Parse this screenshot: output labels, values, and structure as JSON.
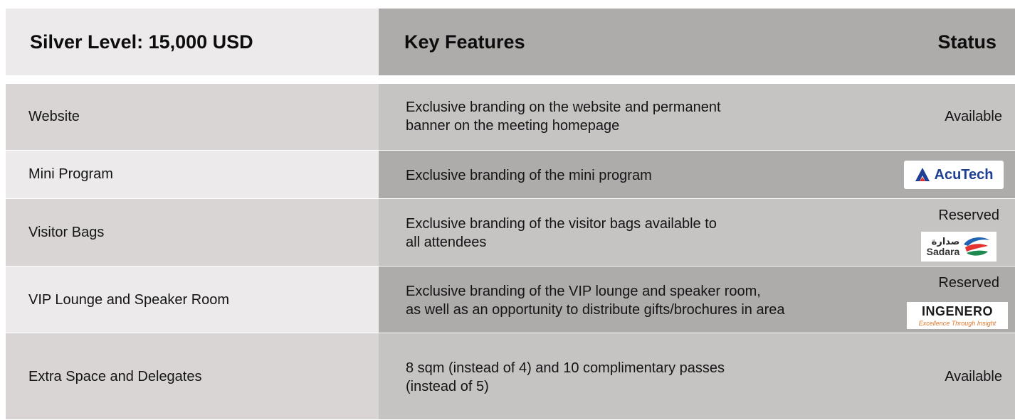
{
  "header": {
    "level": "Silver Level: 15,000 USD",
    "features": "Key Features",
    "status": "Status"
  },
  "rows": [
    {
      "item": "Website",
      "feature_lines": [
        "Exclusive branding on the website and permanent",
        "banner on the meeting homepage"
      ],
      "status": "Available"
    },
    {
      "item": "Mini Program",
      "feature_lines": [
        "Exclusive branding of the mini program"
      ],
      "status": "",
      "sponsor_logo": {
        "name": "AcuTech",
        "icon": "acutech-logo-icon",
        "color": "#1f3f93"
      }
    },
    {
      "item": "Visitor Bags",
      "feature_lines": [
        "Exclusive branding of the visitor bags available to",
        "all attendees"
      ],
      "status": "Reserved",
      "sponsor_logo": {
        "name_ar": "صدارة",
        "name": "Sadara",
        "icon": "sadara-logo-icon"
      }
    },
    {
      "item": "VIP Lounge and Speaker Room",
      "feature_lines": [
        "Exclusive branding of the VIP lounge and speaker room,",
        "as well as an opportunity to distribute gifts/brochures in area"
      ],
      "status": "Reserved",
      "sponsor_logo": {
        "name": "INGENERO",
        "tagline": "Excellence Through Insight",
        "icon": "ingenero-logo-icon",
        "color": "#e0772b"
      }
    },
    {
      "item": "Extra Space and Delegates",
      "feature_lines": [
        "8 sqm (instead of 4) and 10 complimentary passes",
        "(instead of 5)"
      ],
      "status": "Available"
    }
  ]
}
